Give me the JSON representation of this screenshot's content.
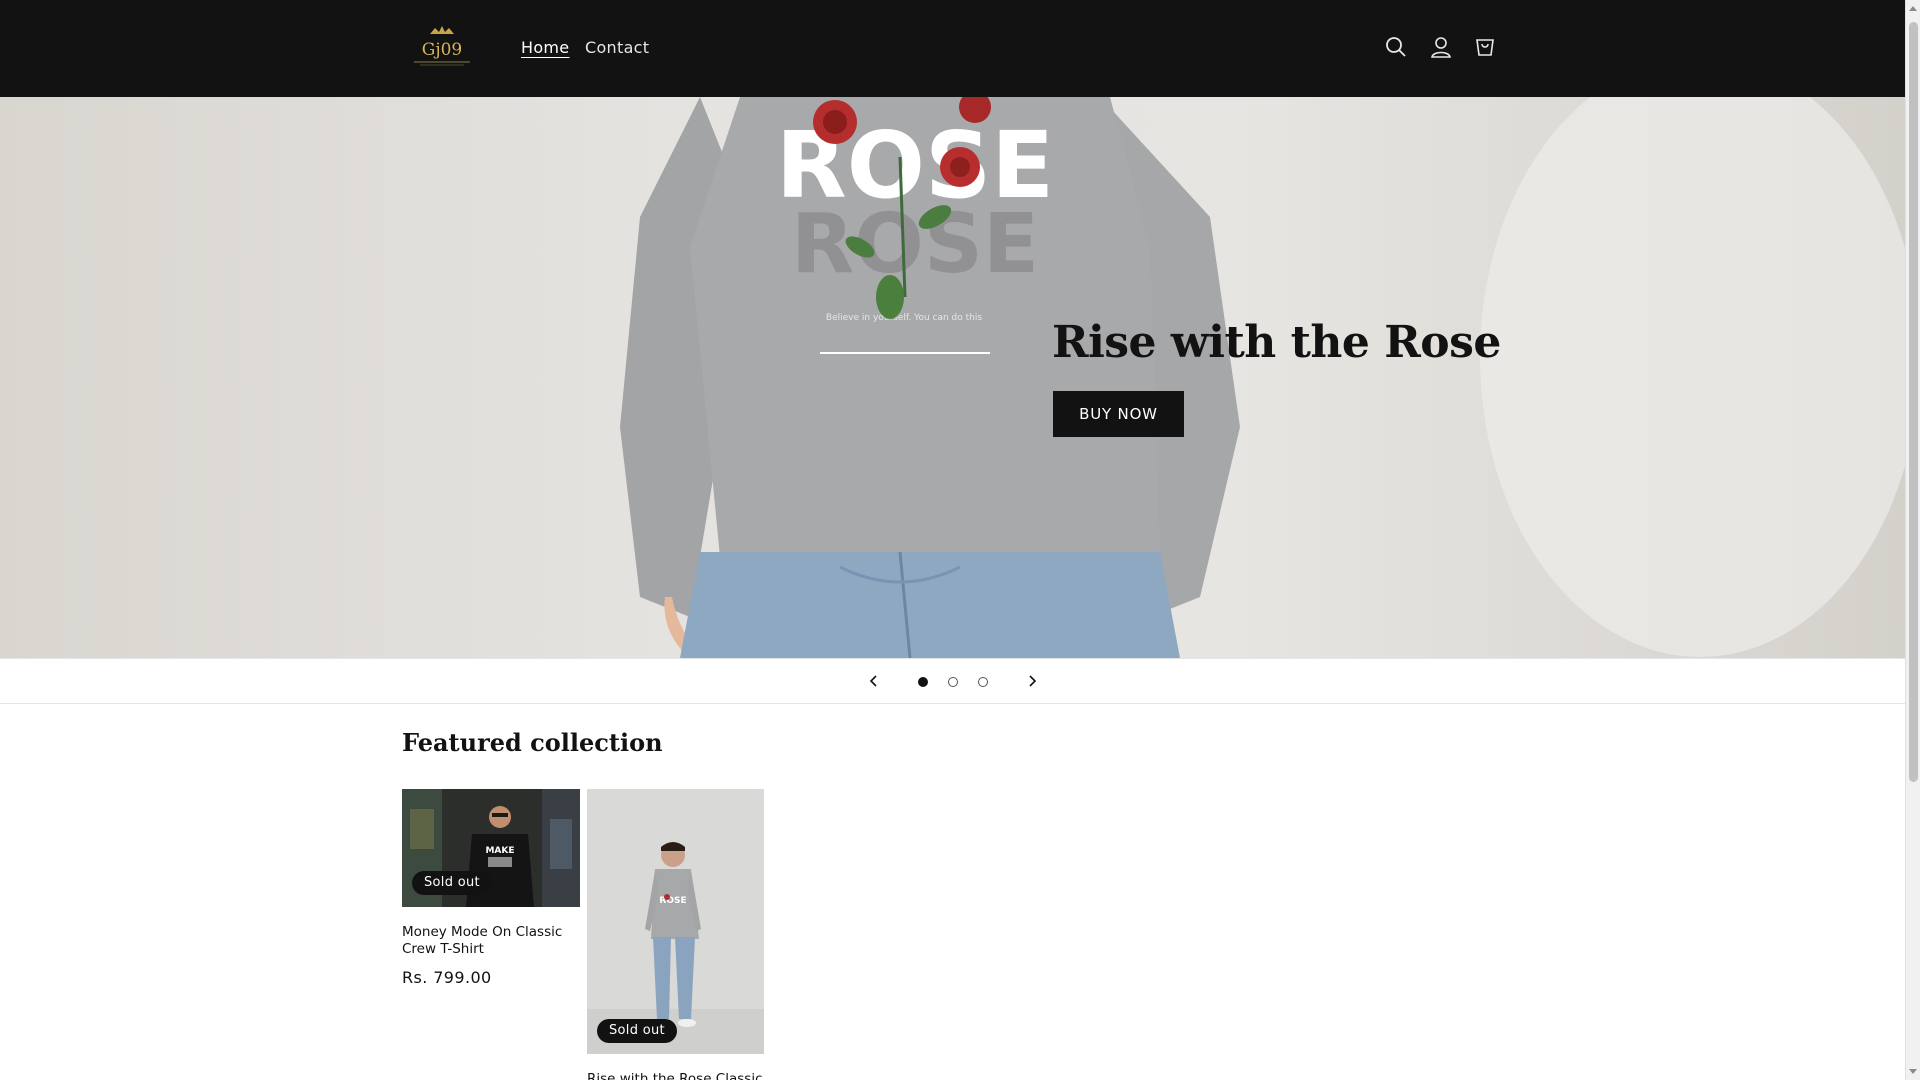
{
  "header": {
    "logo_text": "Gj09",
    "nav": [
      {
        "label": "Home",
        "active": true
      },
      {
        "label": "Contact",
        "active": false
      }
    ],
    "icons": [
      "search-icon",
      "account-icon",
      "cart-icon"
    ]
  },
  "hero": {
    "title": "Rise with the Rose",
    "button_label": "BUY NOW",
    "shirt_print": {
      "word": "ROSE",
      "tagline": "Believe in yourself. You can do this"
    }
  },
  "slider": {
    "slides": 3,
    "active_index": 0,
    "icons": [
      "chevron-left-icon",
      "chevron-right-icon"
    ]
  },
  "collection": {
    "title": "Featured collection",
    "products": [
      {
        "title": "Money Mode On Classic Crew T-Shirt",
        "price": "Rs. 799.00",
        "badge": "Sold out",
        "shirt_text": "MAKE"
      },
      {
        "title": "Rise with the Rose Classic",
        "price": "",
        "badge": "Sold out",
        "shirt_text": "ROSE"
      }
    ]
  },
  "colors": {
    "header_bg": "#121212",
    "button_bg": "#121212",
    "badge_bg": "#121212",
    "page_bg": "#ffffff"
  }
}
